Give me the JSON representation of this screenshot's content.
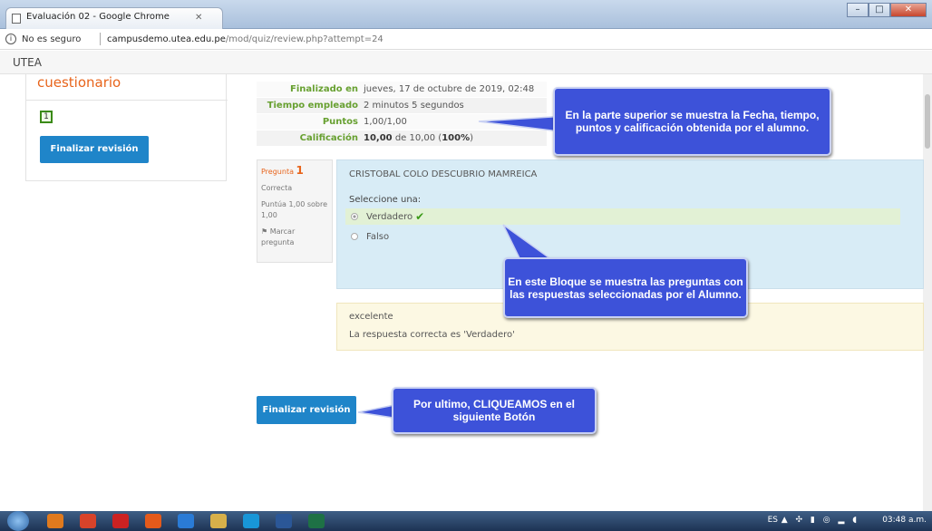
{
  "window": {
    "tab_title": "Evaluación 02 - Google Chrome"
  },
  "address": {
    "security": "No es seguro",
    "host": "campusdemo.utea.edu.pe",
    "path": "/mod/quiz/review.php?attempt=24"
  },
  "site": {
    "brand": "UTEA"
  },
  "nav": {
    "title": "cuestionario",
    "question_number": "1",
    "finish_label": "Finalizar revisión"
  },
  "summary": [
    {
      "label": "Finalizado en",
      "value": "jueves, 17 de octubre de 2019, 02:48"
    },
    {
      "label": "Tiempo empleado",
      "value": "2 minutos 5 segundos"
    },
    {
      "label": "Puntos",
      "value": "1,00/1,00"
    },
    {
      "label": "Calificación",
      "value_bold": "10,00",
      "value_mid": " de 10,00 (",
      "value_pct": "100%",
      "value_end": ")"
    }
  ],
  "question_info": {
    "prefix": "Pregunta",
    "number": "1",
    "state": "Correcta",
    "grade": "Puntúa 1,00 sobre 1,00",
    "flag": "Marcar pregunta"
  },
  "question": {
    "text": "CRISTOBAL COLO DESCUBRIO MAMREICA",
    "prompt": "Seleccione una:",
    "options": [
      {
        "label": "Verdadero"
      },
      {
        "label": "Falso"
      }
    ]
  },
  "feedback": {
    "general": "excelente",
    "right_answer": "La respuesta correcta es 'Verdadero'"
  },
  "main": {
    "finish_label": "Finalizar revisión"
  },
  "callouts": {
    "top": "En la parte superior se muestra la Fecha,  tiempo, puntos y calificación obtenida por el alumno.",
    "middle": "En este Bloque se muestra las preguntas con las respuestas seleccionadas por el Alumno.",
    "bottom": "Por ultimo, CLIQUEAMOS en el siguiente Botón"
  },
  "taskbar": {
    "lang": "ES",
    "time": "03:48 a.m."
  },
  "colors": {
    "accent": "#e8641b",
    "button": "#1f85c9",
    "callout": "#3d52d9",
    "success": "#67a030"
  }
}
